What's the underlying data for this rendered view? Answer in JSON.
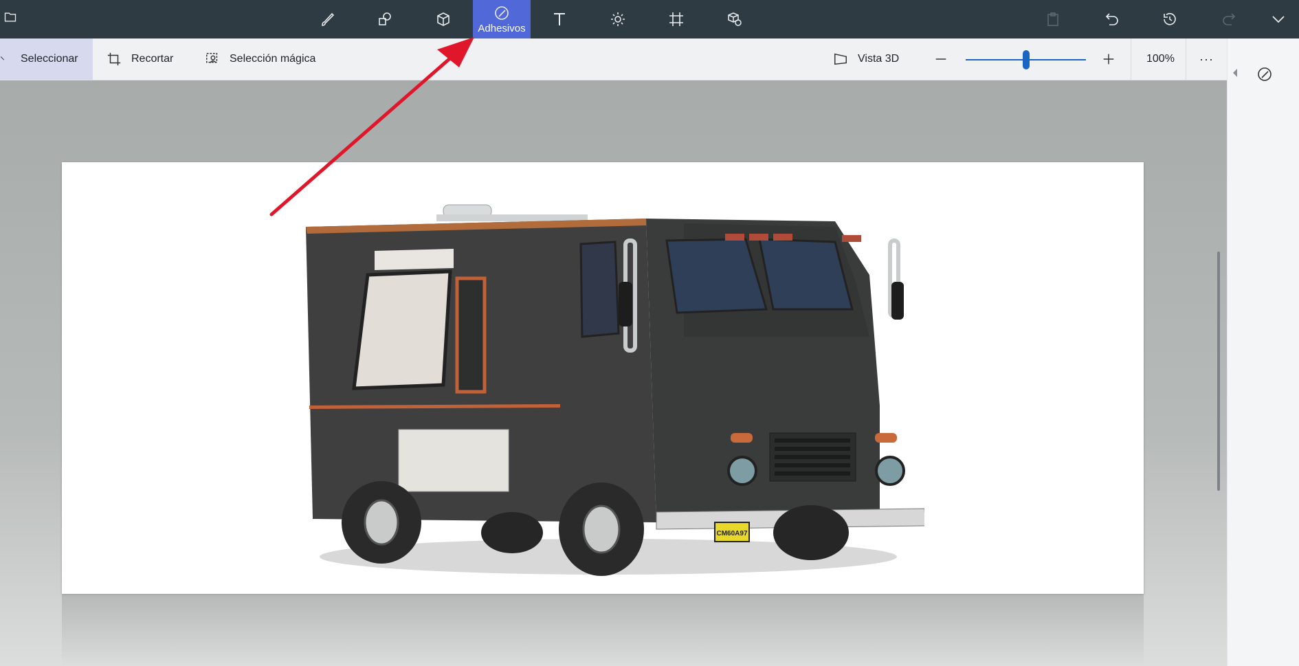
{
  "toolbar": {
    "tools": [
      {
        "name": "brush-tool-button",
        "icon": "brush-icon",
        "label": ""
      },
      {
        "name": "shapes-2d-tool-button",
        "icon": "2d-shapes-icon",
        "label": ""
      },
      {
        "name": "shapes-3d-tool-button",
        "icon": "3d-cube-icon",
        "label": ""
      },
      {
        "name": "stickers-tool-button",
        "icon": "sticker-icon",
        "label": "Adhesivos",
        "active": true
      },
      {
        "name": "text-tool-button",
        "icon": "text-icon",
        "label": ""
      },
      {
        "name": "effects-tool-button",
        "icon": "sun-icon",
        "label": ""
      },
      {
        "name": "canvas-tool-button",
        "icon": "canvas-crop-icon",
        "label": ""
      },
      {
        "name": "library-3d-tool-button",
        "icon": "3d-library-icon",
        "label": ""
      }
    ],
    "active_color": "#5168d9"
  },
  "subbar": {
    "select_label": "Seleccionar",
    "crop_label": "Recortar",
    "magic_select_label": "Selección mágica",
    "view3d_label": "Vista 3D",
    "zoom_value": "100%",
    "zoom_fraction": 0.57,
    "more_label": "···"
  },
  "canvas": {
    "plate_text": "CM60A97"
  },
  "colors": {
    "topbar": "#2f3b43",
    "annotation_arrow": "#e0162b",
    "slider": "#1a64c4"
  }
}
